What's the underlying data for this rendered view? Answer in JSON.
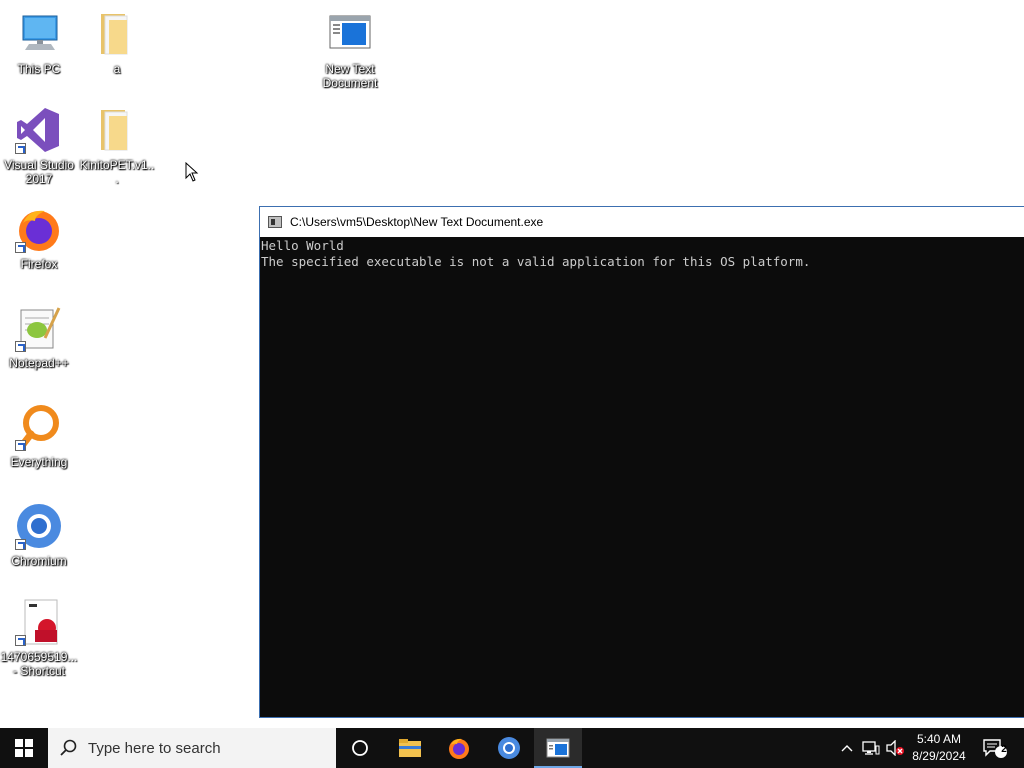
{
  "desktop": {
    "icons": {
      "this_pc": "This PC",
      "folder_a": "a",
      "new_text_document": "New Text Document",
      "visual_studio": "Visual Studio 2017",
      "kinito": "KinitoPET.v1...",
      "firefox": "Firefox",
      "notepadpp": "Notepad++",
      "everything": "Everything",
      "chromium": "Chromium",
      "shortcut_file": "1470659519... - Shortcut"
    }
  },
  "console": {
    "title": "C:\\Users\\vm5\\Desktop\\New Text Document.exe",
    "line1": "Hello World",
    "line2": "The specified executable is not a valid application for this OS platform."
  },
  "taskbar": {
    "search_placeholder": "Type here to search",
    "time": "5:40 AM",
    "date": "8/29/2024",
    "notification_count": "2"
  },
  "colors": {
    "taskbar_bg": "#101010",
    "console_bg": "#0c0c0c",
    "console_text": "#cccccc",
    "accent": "#6ea7e6"
  }
}
